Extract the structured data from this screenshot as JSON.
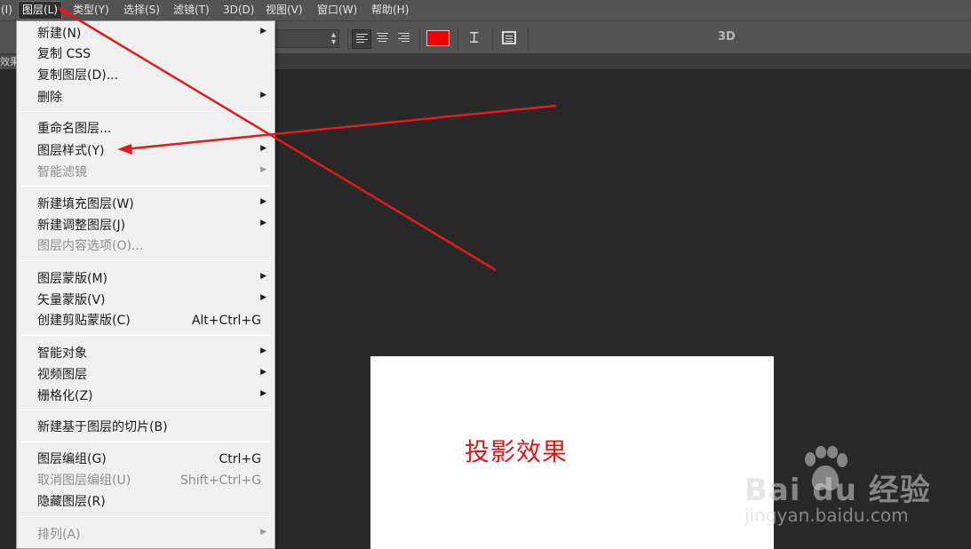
{
  "menubar": {
    "items": [
      "(I)",
      "图层(L)",
      "类型(Y)",
      "选择(S)",
      "滤镜(T)",
      "3D(D)",
      "视图(V)",
      "窗口(W)",
      "帮助(H)"
    ]
  },
  "options_bar": {
    "text_color": "#ee0000",
    "threed_label": "3D"
  },
  "tab_stub": "效果",
  "layer_menu": {
    "items": [
      {
        "label": "新建(N)",
        "submenu": true
      },
      {
        "label": "复制 CSS"
      },
      {
        "label": "复制图层(D)..."
      },
      {
        "label": "删除",
        "submenu": true
      },
      {
        "label": "重命名图层..."
      },
      {
        "label": "图层样式(Y)",
        "submenu": true
      },
      {
        "label": "智能滤镜",
        "submenu": true,
        "disabled": true
      },
      {
        "label": "新建填充图层(W)",
        "submenu": true
      },
      {
        "label": "新建调整图层(J)",
        "submenu": true
      },
      {
        "label": "图层内容选项(O)...",
        "disabled": true
      },
      {
        "label": "图层蒙版(M)",
        "submenu": true
      },
      {
        "label": "矢量蒙版(V)",
        "submenu": true
      },
      {
        "label": "创建剪贴蒙版(C)",
        "shortcut": "Alt+Ctrl+G"
      },
      {
        "label": "智能对象",
        "submenu": true
      },
      {
        "label": "视频图层",
        "submenu": true
      },
      {
        "label": "栅格化(Z)",
        "submenu": true
      },
      {
        "label": "新建基于图层的切片(B)"
      },
      {
        "label": "图层编组(G)",
        "shortcut": "Ctrl+G"
      },
      {
        "label": "取消图层编组(U)",
        "shortcut": "Shift+Ctrl+G",
        "disabled": true
      },
      {
        "label": "隐藏图层(R)"
      },
      {
        "label": "排列(A)",
        "submenu": true,
        "disabled": true
      }
    ]
  },
  "canvas": {
    "text": "投影效果"
  },
  "watermark": {
    "brand": "Bai du 经验",
    "url": "jingyan.baidu.com"
  },
  "annotation_color": "#e11b1b"
}
